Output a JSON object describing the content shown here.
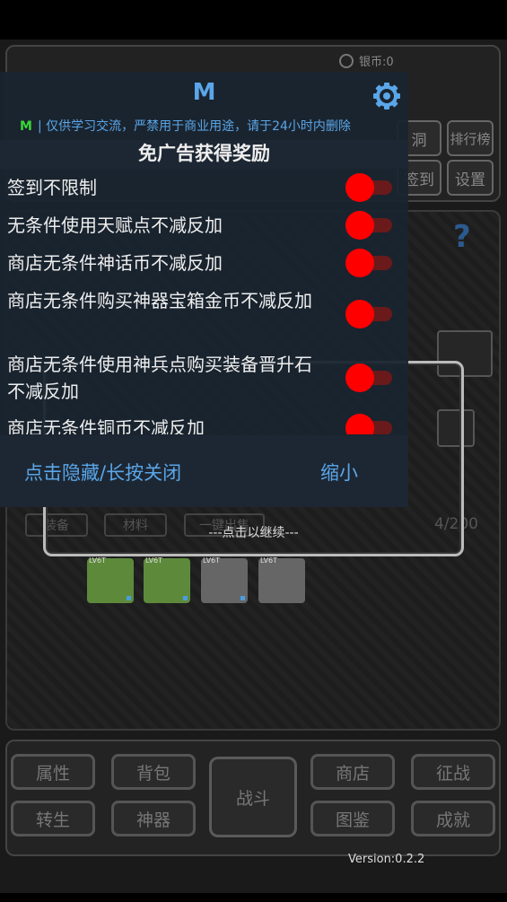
{
  "game": {
    "silver_label": "银币:0",
    "top_buttons": [
      "洞",
      "排行榜",
      "签到",
      "设置"
    ],
    "question_mark": "?",
    "tabs": [
      "装备",
      "材料",
      "一键出售"
    ],
    "counter": "4/200",
    "item_tags": [
      "LV6T",
      "LV6T",
      "LV6T",
      "LV6T"
    ],
    "bottom_buttons": {
      "attributes": "属性",
      "backpack": "背包",
      "battle": "战斗",
      "shop": "商店",
      "expedition": "征战",
      "rebirth": "转生",
      "artifact": "神器",
      "codex": "图鉴",
      "achievement": "成就"
    },
    "version": "Version:0.2.2"
  },
  "continue_dialog": {
    "text": "---点击以继续---"
  },
  "menu": {
    "title": "M",
    "notice_tag": "M",
    "notice_text": "| 仅供学习交流，严禁用于商业用途，请于24小时内删除",
    "section_title": "免广告获得奖励",
    "items": [
      {
        "label": "签到不限制",
        "enabled": true
      },
      {
        "label": "无条件使用天赋点不减反加",
        "enabled": true
      },
      {
        "label": "商店无条件神话币不减反加",
        "enabled": true
      },
      {
        "label": "商店无条件购买神器宝箱金币不减反加",
        "enabled": true
      },
      {
        "label": "商店无条件使用神兵点购买装备晋升石不减反加",
        "enabled": true
      },
      {
        "label": "商店无条件铜币不减反加",
        "enabled": true
      }
    ],
    "hide_button": "点击隐藏/长按关闭",
    "minimize_button": "缩小",
    "colors": {
      "accent": "#5aa6e8",
      "toggle_on": "#ff0000",
      "notice_tag": "#3ad63a"
    }
  }
}
